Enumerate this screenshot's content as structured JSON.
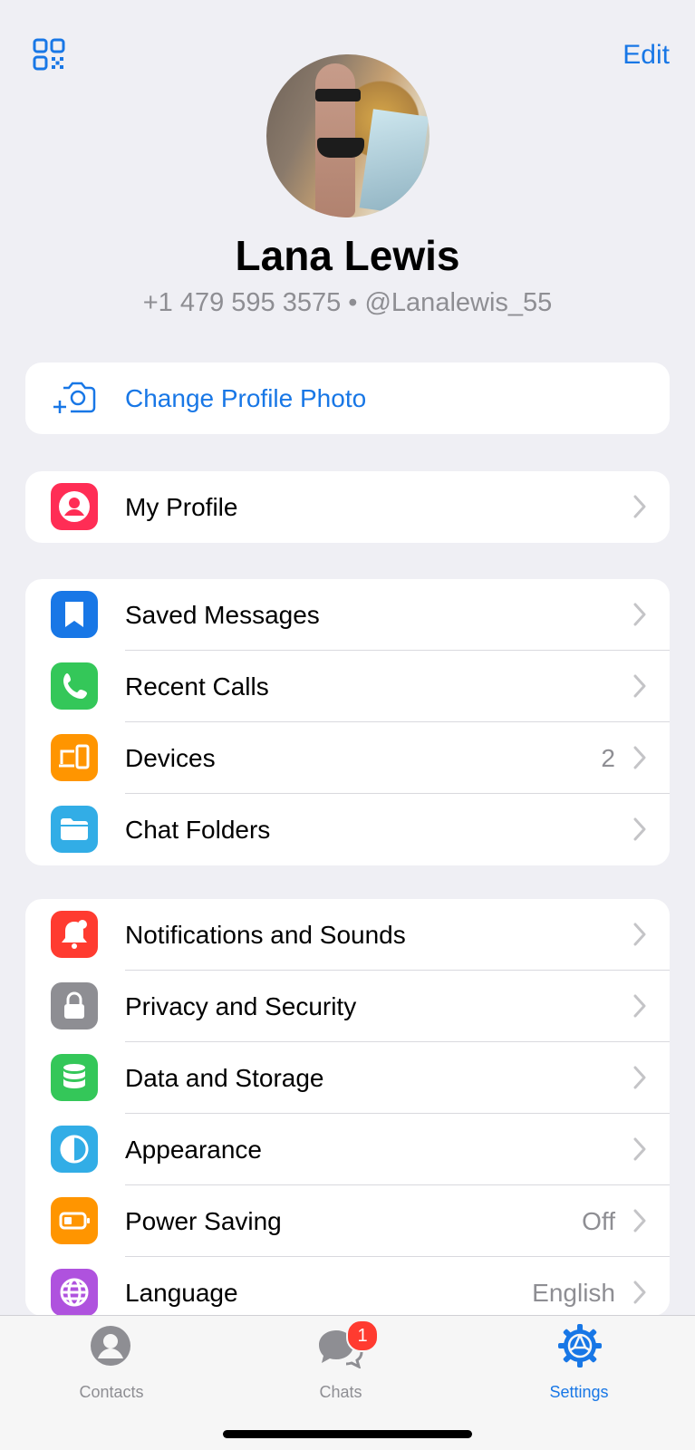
{
  "header": {
    "edit_label": "Edit"
  },
  "profile": {
    "name": "Lana Lewis",
    "subtitle": "+1 479 595 3575 • @Lanalewis_55"
  },
  "change_photo": {
    "label": "Change Profile Photo"
  },
  "group1": [
    {
      "label": "My Profile",
      "icon": "person-icon",
      "color": "#ff2d55"
    }
  ],
  "group2": [
    {
      "label": "Saved Messages",
      "icon": "bookmark-icon",
      "color": "#1877e6"
    },
    {
      "label": "Recent Calls",
      "icon": "phone-icon",
      "color": "#34c759"
    },
    {
      "label": "Devices",
      "value": "2",
      "icon": "devices-icon",
      "color": "#ff9500"
    },
    {
      "label": "Chat Folders",
      "icon": "folder-icon",
      "color": "#32ade6"
    }
  ],
  "group3": [
    {
      "label": "Notifications and Sounds",
      "icon": "bell-icon",
      "color": "#ff3b30"
    },
    {
      "label": "Privacy and Security",
      "icon": "lock-icon",
      "color": "#8e8e93"
    },
    {
      "label": "Data and Storage",
      "icon": "database-icon",
      "color": "#34c759"
    },
    {
      "label": "Appearance",
      "icon": "half-circle-icon",
      "color": "#32ade6"
    },
    {
      "label": "Power Saving",
      "value": "Off",
      "icon": "battery-icon",
      "color": "#ff9500"
    },
    {
      "label": "Language",
      "value": "English",
      "icon": "globe-icon",
      "color": "#af52de"
    }
  ],
  "tabs": [
    {
      "label": "Contacts",
      "icon": "contacts-icon"
    },
    {
      "label": "Chats",
      "icon": "chats-icon",
      "badge": "1"
    },
    {
      "label": "Settings",
      "icon": "settings-icon",
      "active": true
    }
  ],
  "accent": "#1877e6"
}
